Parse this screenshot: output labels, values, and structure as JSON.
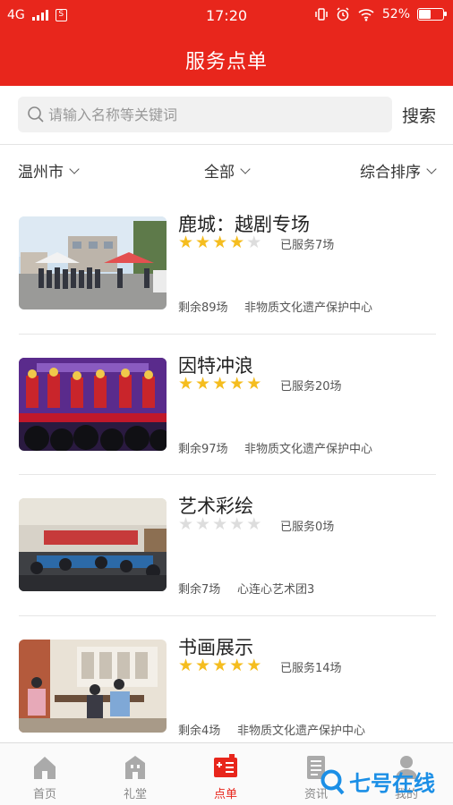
{
  "status": {
    "network": "4G",
    "time": "17:20",
    "battery": "52%",
    "battery_level": 0.52
  },
  "header": {
    "title": "服务点单"
  },
  "search": {
    "placeholder": "请输入名称等关键词",
    "value": "",
    "button_label": "搜索"
  },
  "filters": {
    "city": "温州市",
    "category": "全部",
    "sort": "综合排序"
  },
  "items": [
    {
      "name": "鹿城：越剧专场",
      "rating": 4,
      "served": "已服务7场",
      "remaining": "剩余89场",
      "org": "非物质文化遗产保护中心"
    },
    {
      "name": "因特冲浪",
      "rating": 5,
      "served": "已服务20场",
      "remaining": "剩余97场",
      "org": "非物质文化遗产保护中心"
    },
    {
      "name": "艺术彩绘",
      "rating": 0,
      "served": "已服务0场",
      "remaining": "剩余7场",
      "org": "心连心艺术团3"
    },
    {
      "name": "书画展示",
      "rating": 5,
      "served": "已服务14场",
      "remaining": "剩余4场",
      "org": "非物质文化遗产保护中心"
    }
  ],
  "tabs": [
    {
      "label": "首页",
      "icon": "home-icon"
    },
    {
      "label": "礼堂",
      "icon": "hall-icon"
    },
    {
      "label": "点单",
      "icon": "order-icon"
    },
    {
      "label": "资讯",
      "icon": "news-icon"
    },
    {
      "label": "我的",
      "icon": "user-icon"
    }
  ],
  "active_tab": "点单",
  "watermark": "七号在线",
  "colors": {
    "brand_red": "#e8261c",
    "star_on": "#f5bd1f",
    "star_off": "#dddddd"
  }
}
